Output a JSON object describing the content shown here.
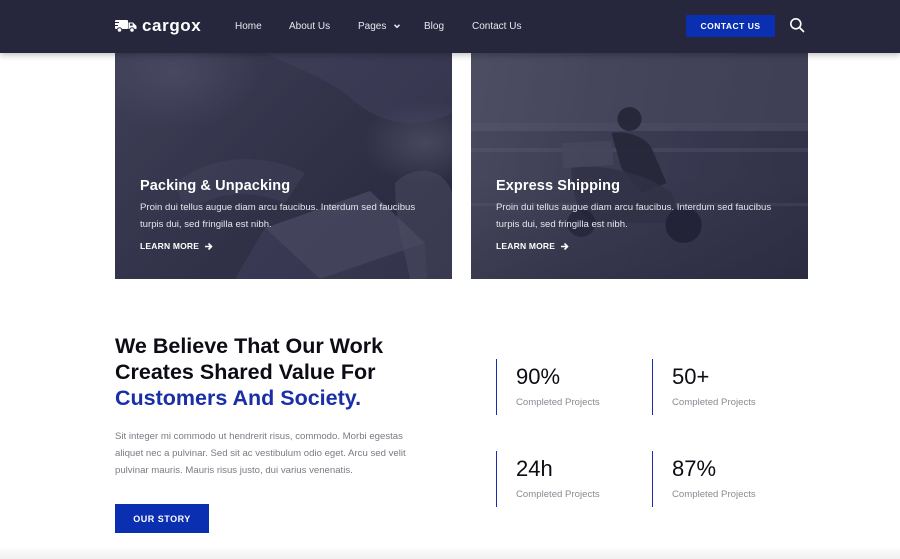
{
  "header": {
    "logo_text": "cargox",
    "nav": [
      {
        "label": "Home",
        "has_dropdown": false
      },
      {
        "label": "About Us",
        "has_dropdown": false
      },
      {
        "label": "Pages",
        "has_dropdown": true
      },
      {
        "label": "Blog",
        "has_dropdown": false
      },
      {
        "label": "Contact Us",
        "has_dropdown": false
      }
    ],
    "contact_button": "CONTACT US",
    "search_icon": "search-icon"
  },
  "services": [
    {
      "title": "Packing & Unpacking",
      "description": "Proin dui tellus augue diam arcu faucibus. Interdum sed faucibus turpis dui, sed fringilla est nibh.",
      "link": "LEARN MORE"
    },
    {
      "title": "Express Shipping",
      "description": "Proin dui tellus augue diam arcu faucibus. Interdum sed faucibus turpis dui, sed fringilla est nibh.",
      "link": "LEARN MORE"
    }
  ],
  "about": {
    "heading_line1": "We Believe That Our Work",
    "heading_line2": "Creates Shared Value For",
    "heading_accent": "Customers And Society.",
    "text": "Sit integer mi commodo ut hendrerit risus, commodo. Morbi egestas aliquet nec a pulvinar. Sed sit ac vestibulum odio eget. Arcu sed velit pulvinar mauris. Mauris risus justo, dui varius venenatis.",
    "button": "OUR STORY"
  },
  "stats": [
    {
      "value": "90%",
      "label": "Completed Projects"
    },
    {
      "value": "50+",
      "label": "Completed Projects"
    },
    {
      "value": "24h",
      "label": "Completed Projects"
    },
    {
      "value": "87%",
      "label": "Completed Projects"
    }
  ],
  "colors": {
    "header_bg": "#26263c",
    "accent": "#0a2fb0",
    "heading_accent": "#1a2ea8",
    "body_text": "#7a7a84"
  }
}
